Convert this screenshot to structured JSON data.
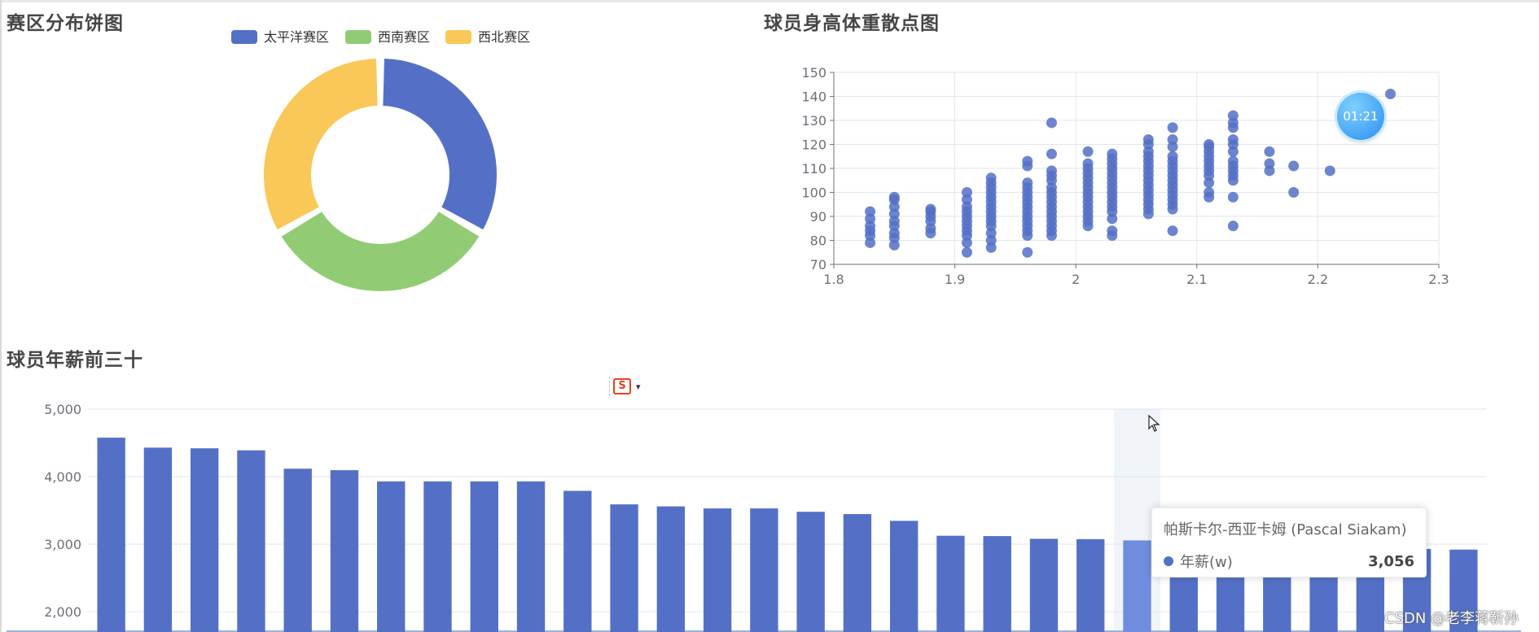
{
  "pie_panel": {
    "title": "赛区分布饼图"
  },
  "scatter_panel": {
    "title": "球员身高体重散点图"
  },
  "bar_panel": {
    "title": "球员年薪前三十"
  },
  "tooltip": {
    "title": "帕斯卡尔-西亚卡姆 (Pascal Siakam)",
    "series_name": "年薪(w)",
    "value": "3,056"
  },
  "timer": {
    "text": "01:21"
  },
  "toolbox": {
    "logo": "S",
    "caret": "▾"
  },
  "watermark": {
    "text": "CSDN @老李蒋靳孙"
  },
  "colors": {
    "blue": "#5470c6",
    "green": "#91cc75",
    "yellow": "#fac858",
    "highlight": "#6f8ddf",
    "axis": "#6e7079",
    "grid": "#e0e6f1"
  },
  "chart_data": [
    {
      "type": "pie",
      "title": "赛区分布饼图",
      "donut": true,
      "legend_position": "top",
      "series": [
        {
          "name": "太平洋赛区",
          "value": 10,
          "color": "#5470c6"
        },
        {
          "name": "西南赛区",
          "value": 10,
          "color": "#91cc75"
        },
        {
          "name": "西北赛区",
          "value": 10,
          "color": "#fac858"
        }
      ]
    },
    {
      "type": "scatter",
      "title": "球员身高体重散点图",
      "xlim": [
        1.8,
        2.3
      ],
      "ylim": [
        70,
        150
      ],
      "xticks": [
        "1.8",
        "1.9",
        "2",
        "2.1",
        "2.2",
        "2.3"
      ],
      "yticks": [
        "70",
        "80",
        "90",
        "100",
        "110",
        "120",
        "130",
        "140",
        "150"
      ],
      "grid": true,
      "points": [
        [
          1.83,
          79
        ],
        [
          1.83,
          82
        ],
        [
          1.83,
          84
        ],
        [
          1.83,
          86
        ],
        [
          1.83,
          89
        ],
        [
          1.83,
          92
        ],
        [
          1.85,
          78
        ],
        [
          1.85,
          81
        ],
        [
          1.85,
          83
        ],
        [
          1.85,
          86
        ],
        [
          1.85,
          88
        ],
        [
          1.85,
          91
        ],
        [
          1.85,
          94
        ],
        [
          1.85,
          97
        ],
        [
          1.85,
          98
        ],
        [
          1.88,
          83
        ],
        [
          1.88,
          85
        ],
        [
          1.88,
          88
        ],
        [
          1.88,
          90
        ],
        [
          1.88,
          92
        ],
        [
          1.88,
          93
        ],
        [
          1.91,
          75
        ],
        [
          1.91,
          79
        ],
        [
          1.91,
          82
        ],
        [
          1.91,
          84
        ],
        [
          1.91,
          86
        ],
        [
          1.91,
          88
        ],
        [
          1.91,
          90
        ],
        [
          1.91,
          92
        ],
        [
          1.91,
          94
        ],
        [
          1.91,
          97
        ],
        [
          1.91,
          100
        ],
        [
          1.93,
          77
        ],
        [
          1.93,
          80
        ],
        [
          1.93,
          83
        ],
        [
          1.93,
          86
        ],
        [
          1.93,
          88
        ],
        [
          1.93,
          90
        ],
        [
          1.93,
          92
        ],
        [
          1.93,
          94
        ],
        [
          1.93,
          96
        ],
        [
          1.93,
          98
        ],
        [
          1.93,
          100
        ],
        [
          1.93,
          102
        ],
        [
          1.93,
          104
        ],
        [
          1.93,
          106
        ],
        [
          1.96,
          75
        ],
        [
          1.96,
          82
        ],
        [
          1.96,
          84
        ],
        [
          1.96,
          86
        ],
        [
          1.96,
          88
        ],
        [
          1.96,
          90
        ],
        [
          1.96,
          92
        ],
        [
          1.96,
          94
        ],
        [
          1.96,
          96
        ],
        [
          1.96,
          98
        ],
        [
          1.96,
          100
        ],
        [
          1.96,
          102
        ],
        [
          1.96,
          104
        ],
        [
          1.96,
          111
        ],
        [
          1.96,
          113
        ],
        [
          1.98,
          82
        ],
        [
          1.98,
          84
        ],
        [
          1.98,
          86
        ],
        [
          1.98,
          88
        ],
        [
          1.98,
          90
        ],
        [
          1.98,
          92
        ],
        [
          1.98,
          94
        ],
        [
          1.98,
          96
        ],
        [
          1.98,
          98
        ],
        [
          1.98,
          100
        ],
        [
          1.98,
          102
        ],
        [
          1.98,
          105
        ],
        [
          1.98,
          107
        ],
        [
          1.98,
          109
        ],
        [
          1.98,
          116
        ],
        [
          1.98,
          129
        ],
        [
          2.01,
          86
        ],
        [
          2.01,
          88
        ],
        [
          2.01,
          90
        ],
        [
          2.01,
          92
        ],
        [
          2.01,
          94
        ],
        [
          2.01,
          96
        ],
        [
          2.01,
          98
        ],
        [
          2.01,
          100
        ],
        [
          2.01,
          102
        ],
        [
          2.01,
          104
        ],
        [
          2.01,
          106
        ],
        [
          2.01,
          108
        ],
        [
          2.01,
          110
        ],
        [
          2.01,
          112
        ],
        [
          2.01,
          117
        ],
        [
          2.03,
          82
        ],
        [
          2.03,
          84
        ],
        [
          2.03,
          89
        ],
        [
          2.03,
          92
        ],
        [
          2.03,
          94
        ],
        [
          2.03,
          96
        ],
        [
          2.03,
          98
        ],
        [
          2.03,
          100
        ],
        [
          2.03,
          102
        ],
        [
          2.03,
          104
        ],
        [
          2.03,
          106
        ],
        [
          2.03,
          108
        ],
        [
          2.03,
          110
        ],
        [
          2.03,
          112
        ],
        [
          2.03,
          114
        ],
        [
          2.03,
          116
        ],
        [
          2.06,
          91
        ],
        [
          2.06,
          93
        ],
        [
          2.06,
          95
        ],
        [
          2.06,
          97
        ],
        [
          2.06,
          99
        ],
        [
          2.06,
          101
        ],
        [
          2.06,
          103
        ],
        [
          2.06,
          105
        ],
        [
          2.06,
          107
        ],
        [
          2.06,
          109
        ],
        [
          2.06,
          111
        ],
        [
          2.06,
          113
        ],
        [
          2.06,
          115
        ],
        [
          2.06,
          117
        ],
        [
          2.06,
          120
        ],
        [
          2.06,
          122
        ],
        [
          2.08,
          84
        ],
        [
          2.08,
          93
        ],
        [
          2.08,
          95
        ],
        [
          2.08,
          97
        ],
        [
          2.08,
          99
        ],
        [
          2.08,
          101
        ],
        [
          2.08,
          103
        ],
        [
          2.08,
          105
        ],
        [
          2.08,
          107
        ],
        [
          2.08,
          109
        ],
        [
          2.08,
          111
        ],
        [
          2.08,
          113
        ],
        [
          2.08,
          115
        ],
        [
          2.08,
          119
        ],
        [
          2.08,
          122
        ],
        [
          2.08,
          127
        ],
        [
          2.11,
          98
        ],
        [
          2.11,
          100
        ],
        [
          2.11,
          104
        ],
        [
          2.11,
          107
        ],
        [
          2.11,
          109
        ],
        [
          2.11,
          111
        ],
        [
          2.11,
          113
        ],
        [
          2.11,
          115
        ],
        [
          2.11,
          117
        ],
        [
          2.11,
          119
        ],
        [
          2.11,
          120
        ],
        [
          2.13,
          86
        ],
        [
          2.13,
          98
        ],
        [
          2.13,
          105
        ],
        [
          2.13,
          107
        ],
        [
          2.13,
          109
        ],
        [
          2.13,
          111
        ],
        [
          2.13,
          113
        ],
        [
          2.13,
          117
        ],
        [
          2.13,
          120
        ],
        [
          2.13,
          122
        ],
        [
          2.13,
          127
        ],
        [
          2.13,
          129
        ],
        [
          2.13,
          132
        ],
        [
          2.16,
          109
        ],
        [
          2.16,
          112
        ],
        [
          2.16,
          117
        ],
        [
          2.18,
          100
        ],
        [
          2.18,
          111
        ],
        [
          2.21,
          109
        ],
        [
          2.26,
          141
        ]
      ]
    },
    {
      "type": "bar",
      "title": "球员年薪前三十",
      "series_name": "年薪(w)",
      "ylim": [
        1700,
        5000
      ],
      "yticks": [
        "2,000",
        "3,000",
        "4,000",
        "5,000"
      ],
      "grid": true,
      "highlight_index": 22,
      "values": [
        4578,
        4430,
        4420,
        4390,
        4118,
        4096,
        3930,
        3930,
        3930,
        3930,
        3790,
        3590,
        3560,
        3530,
        3530,
        3480,
        3446,
        3346,
        3125,
        3120,
        3080,
        3075,
        3056,
        2990,
        2965,
        2965,
        2930,
        2930,
        2930,
        2920
      ]
    }
  ]
}
